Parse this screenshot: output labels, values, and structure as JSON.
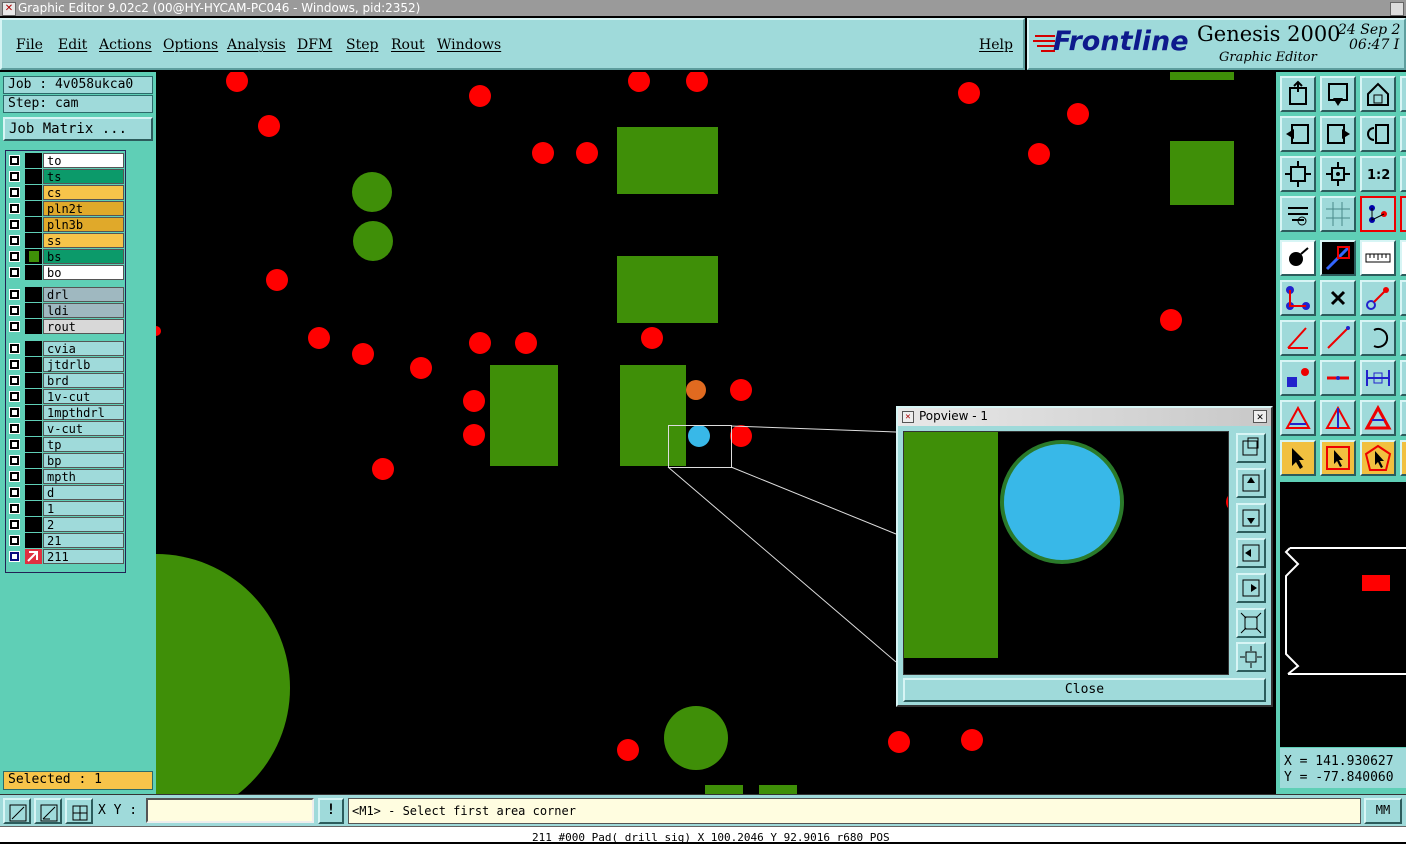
{
  "window": {
    "title": "Graphic Editor 9.02c2 (00@HY-HYCAM-PC046 - Windows, pid:2352)"
  },
  "menu": {
    "file": "File",
    "edit": "Edit",
    "actions": "Actions",
    "options": "Options",
    "analysis": "Analysis",
    "dfm": "DFM",
    "step": "Step",
    "rout": "Rout",
    "windows": "Windows",
    "help": "Help"
  },
  "brand": {
    "logo": "Frontline",
    "product": "Genesis 2000",
    "subtitle": "Graphic Editor",
    "date": "24 Sep 2",
    "time": "06:47 I"
  },
  "job": {
    "job_label": "Job : 4v058ukca0",
    "step_label": "Step: cam",
    "matrix_button": "Job Matrix ..."
  },
  "layers": [
    {
      "name": "to",
      "color": "#ffffff"
    },
    {
      "name": "ts",
      "color": "#0c9a6a"
    },
    {
      "name": "cs",
      "color": "#f7c44a"
    },
    {
      "name": "pln2t",
      "color": "#e0a92a"
    },
    {
      "name": "pln3b",
      "color": "#e0a92a"
    },
    {
      "name": "ss",
      "color": "#f7c44a"
    },
    {
      "name": "bs",
      "color": "#0c9a6a"
    },
    {
      "name": "bo",
      "color": "#ffffff"
    },
    {
      "name": "drl",
      "color": "#9fb8c0"
    },
    {
      "name": "ldi",
      "color": "#9fb8c0"
    },
    {
      "name": "rout",
      "color": "#d8d8d8"
    },
    {
      "name": "cvia",
      "color": "#9fdada"
    },
    {
      "name": "jtdrlb",
      "color": "#9fdada"
    },
    {
      "name": "brd",
      "color": "#9fdada"
    },
    {
      "name": "1v-cut",
      "color": "#9fdada"
    },
    {
      "name": "1mpthdrl",
      "color": "#9fdada"
    },
    {
      "name": "v-cut",
      "color": "#9fdada"
    },
    {
      "name": "tp",
      "color": "#9fdada"
    },
    {
      "name": "bp",
      "color": "#9fdada"
    },
    {
      "name": "mpth",
      "color": "#9fdada"
    },
    {
      "name": "d",
      "color": "#9fdada"
    },
    {
      "name": "1",
      "color": "#9fdada"
    },
    {
      "name": "2",
      "color": "#9fdada"
    },
    {
      "name": "21",
      "color": "#9fdada"
    },
    {
      "name": "211",
      "color": "#9fdada"
    }
  ],
  "selected_label": "Selected : 1",
  "popview": {
    "title": "Popview - 1",
    "close_label": "Close"
  },
  "coords": {
    "x": "X = 141.930627",
    "y": "Y = -77.840060"
  },
  "status": {
    "xy_label": "X Y :",
    "xy_value": "",
    "prompt": "<M1> - Select first area corner",
    "units": "MM"
  },
  "bottom_info": "211 #000 Pad( drill_sig) X 100.2046 Y 92.9016 r680 POS",
  "colors": {
    "panel": "#9fdada",
    "panel_dark": "#5fcfb6",
    "pad_red": "#ff0000",
    "copper_green": "#3f8f08",
    "highlight": "#38b8e8"
  }
}
